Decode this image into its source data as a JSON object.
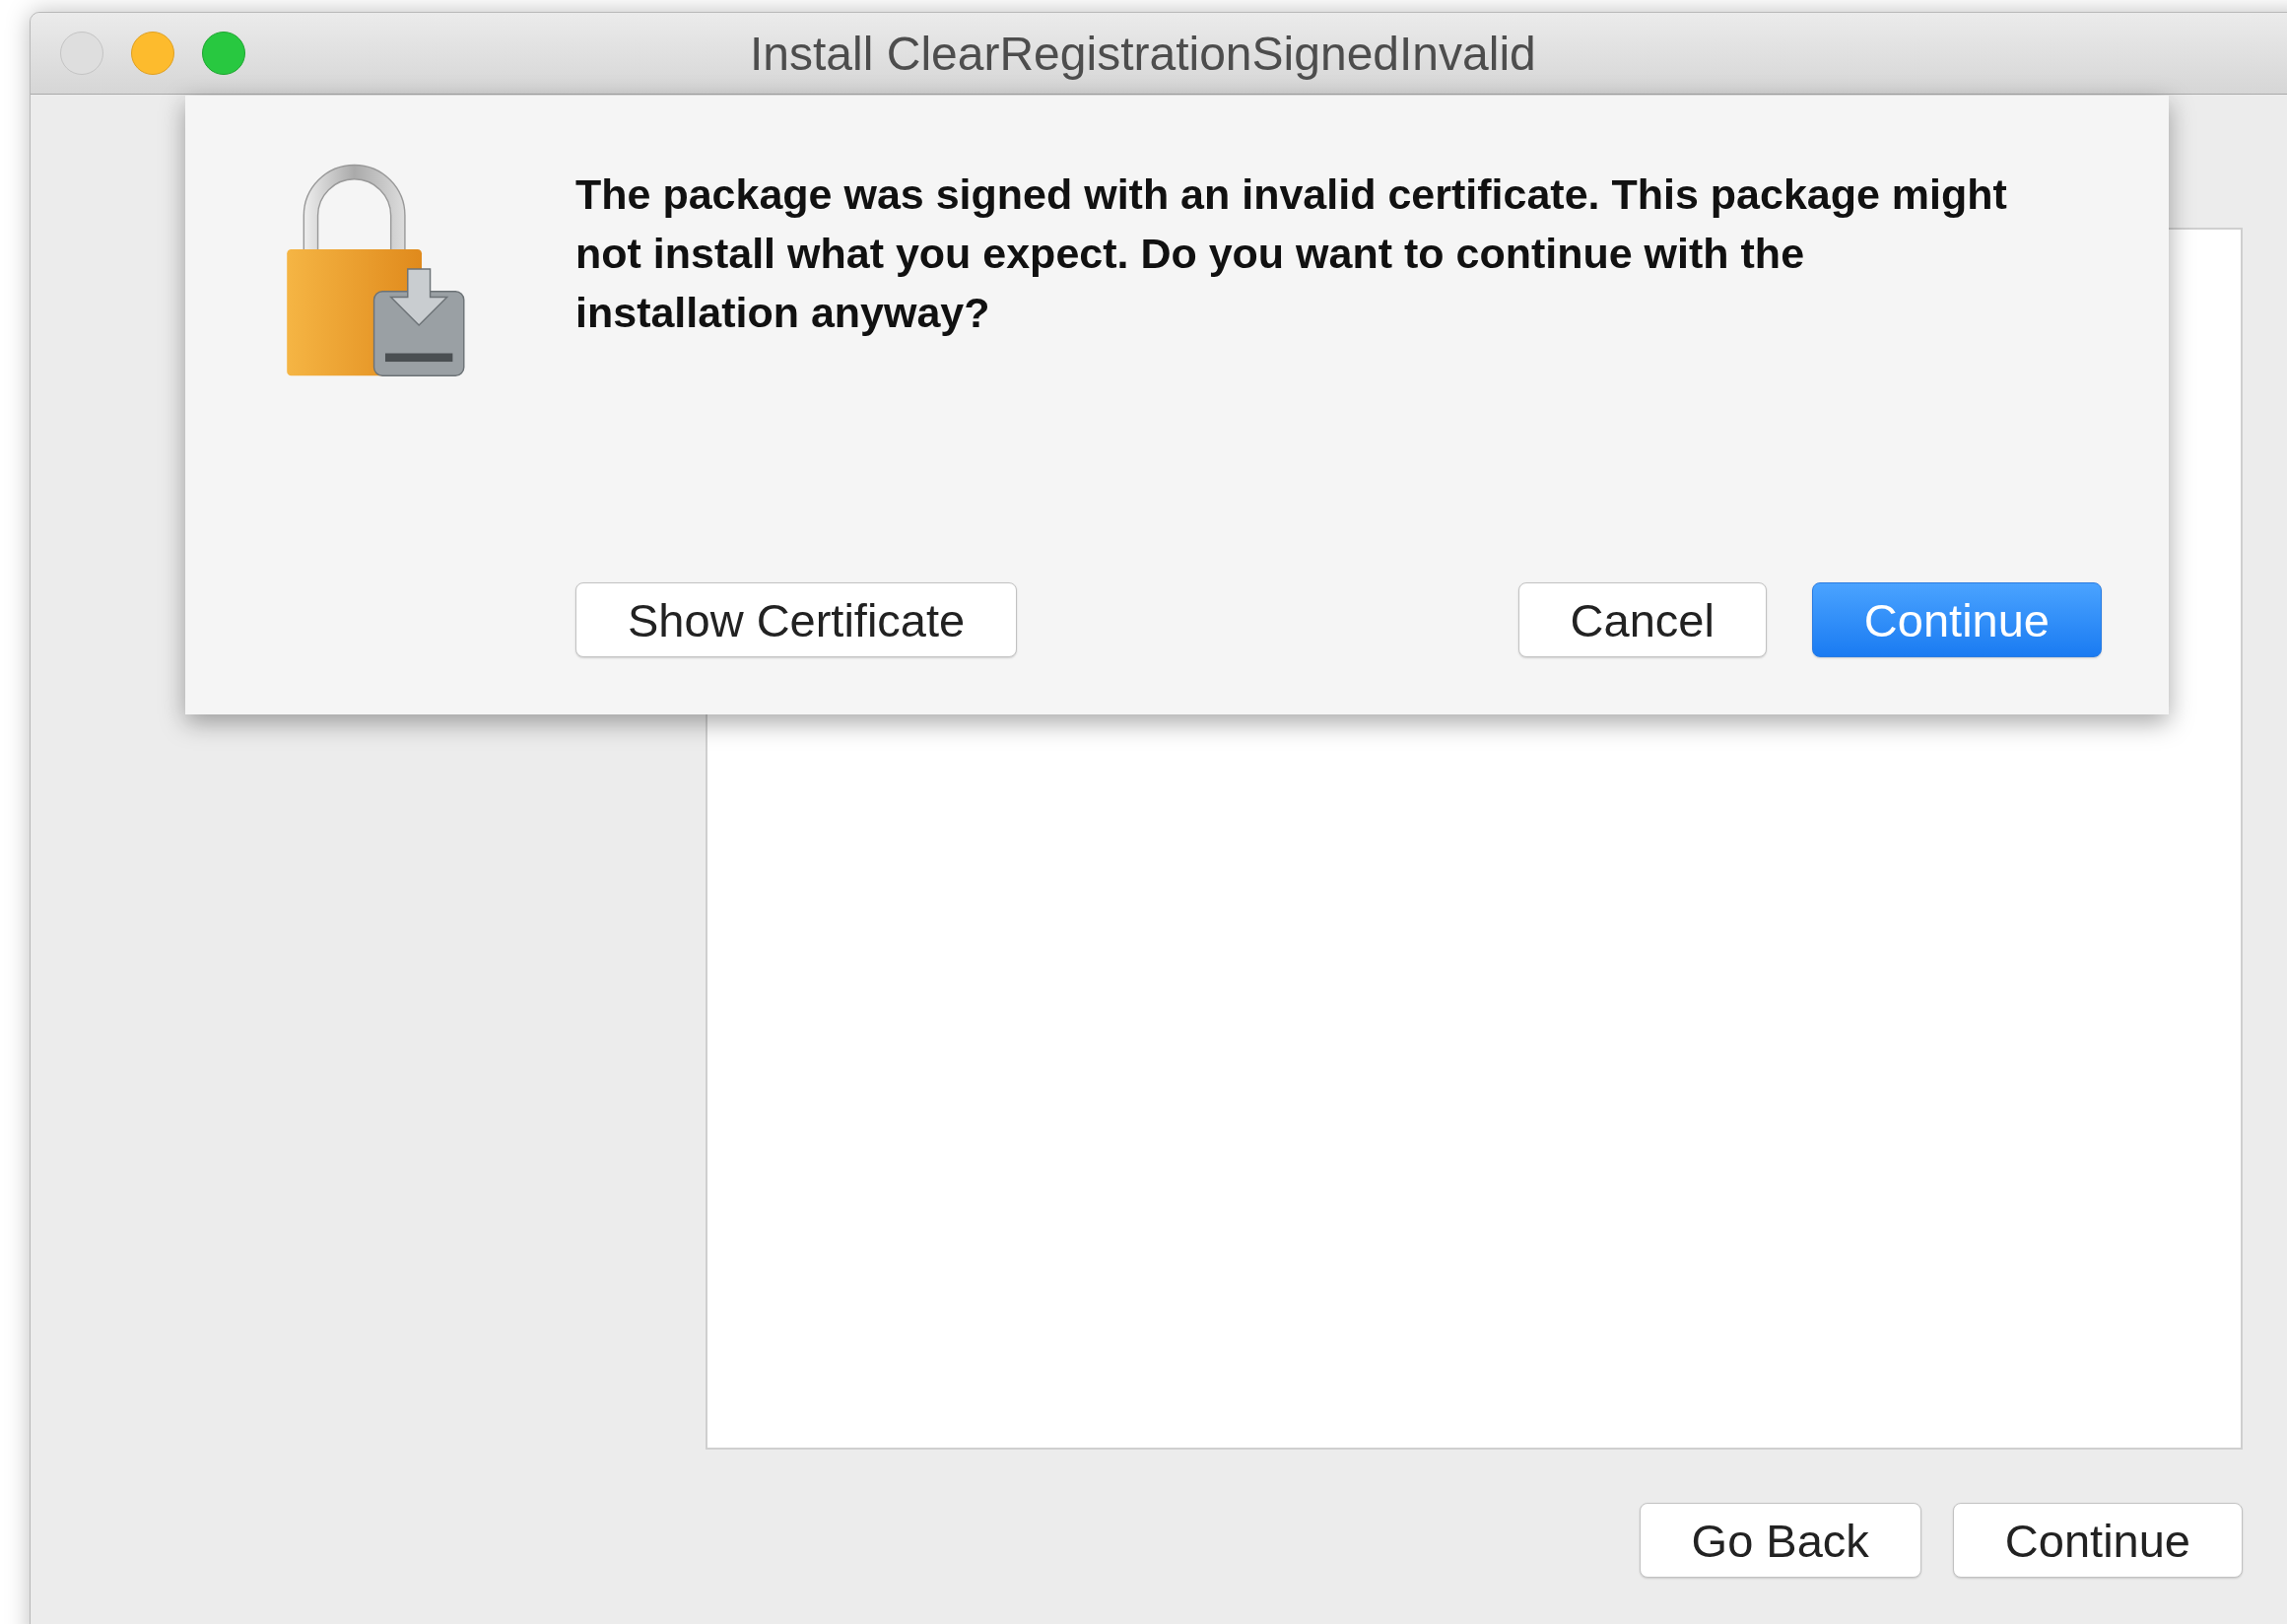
{
  "window": {
    "title": "Install ClearRegistrationSignedInvalid"
  },
  "sheet": {
    "message": "The package was signed with an invalid certificate. This package might not install what you expect. Do you want to continue with the installation anyway?",
    "buttons": [
      {
        "label": "Show Certificate",
        "kind": "secondary"
      },
      {
        "label": "Cancel",
        "kind": "normal"
      },
      {
        "label": "Continue",
        "kind": "default"
      }
    ]
  },
  "footer_buttons": [
    {
      "label": "Go Back"
    },
    {
      "label": "Continue"
    }
  ]
}
